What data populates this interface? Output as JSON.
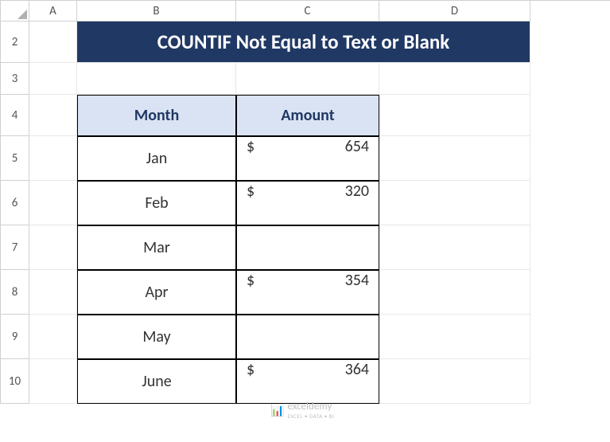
{
  "columns": [
    "A",
    "B",
    "C",
    "D"
  ],
  "rows": [
    "2",
    "3",
    "4",
    "5",
    "6",
    "7",
    "8",
    "9",
    "10"
  ],
  "title": "COUNTIF Not Equal to Text or Blank",
  "headers": {
    "month": "Month",
    "amount": "Amount"
  },
  "chart_data": {
    "type": "table",
    "columns": [
      "Month",
      "Amount"
    ],
    "rows": [
      {
        "month": "Jan",
        "currency": "$",
        "amount": "654"
      },
      {
        "month": "Feb",
        "currency": "$",
        "amount": "320"
      },
      {
        "month": "Mar",
        "currency": "",
        "amount": ""
      },
      {
        "month": "Apr",
        "currency": "$",
        "amount": "354"
      },
      {
        "month": "May",
        "currency": "",
        "amount": ""
      },
      {
        "month": "June",
        "currency": "$",
        "amount": "364"
      }
    ]
  },
  "watermark": {
    "name": "exceldemy",
    "tagline": "EXCEL • DATA • BI"
  }
}
